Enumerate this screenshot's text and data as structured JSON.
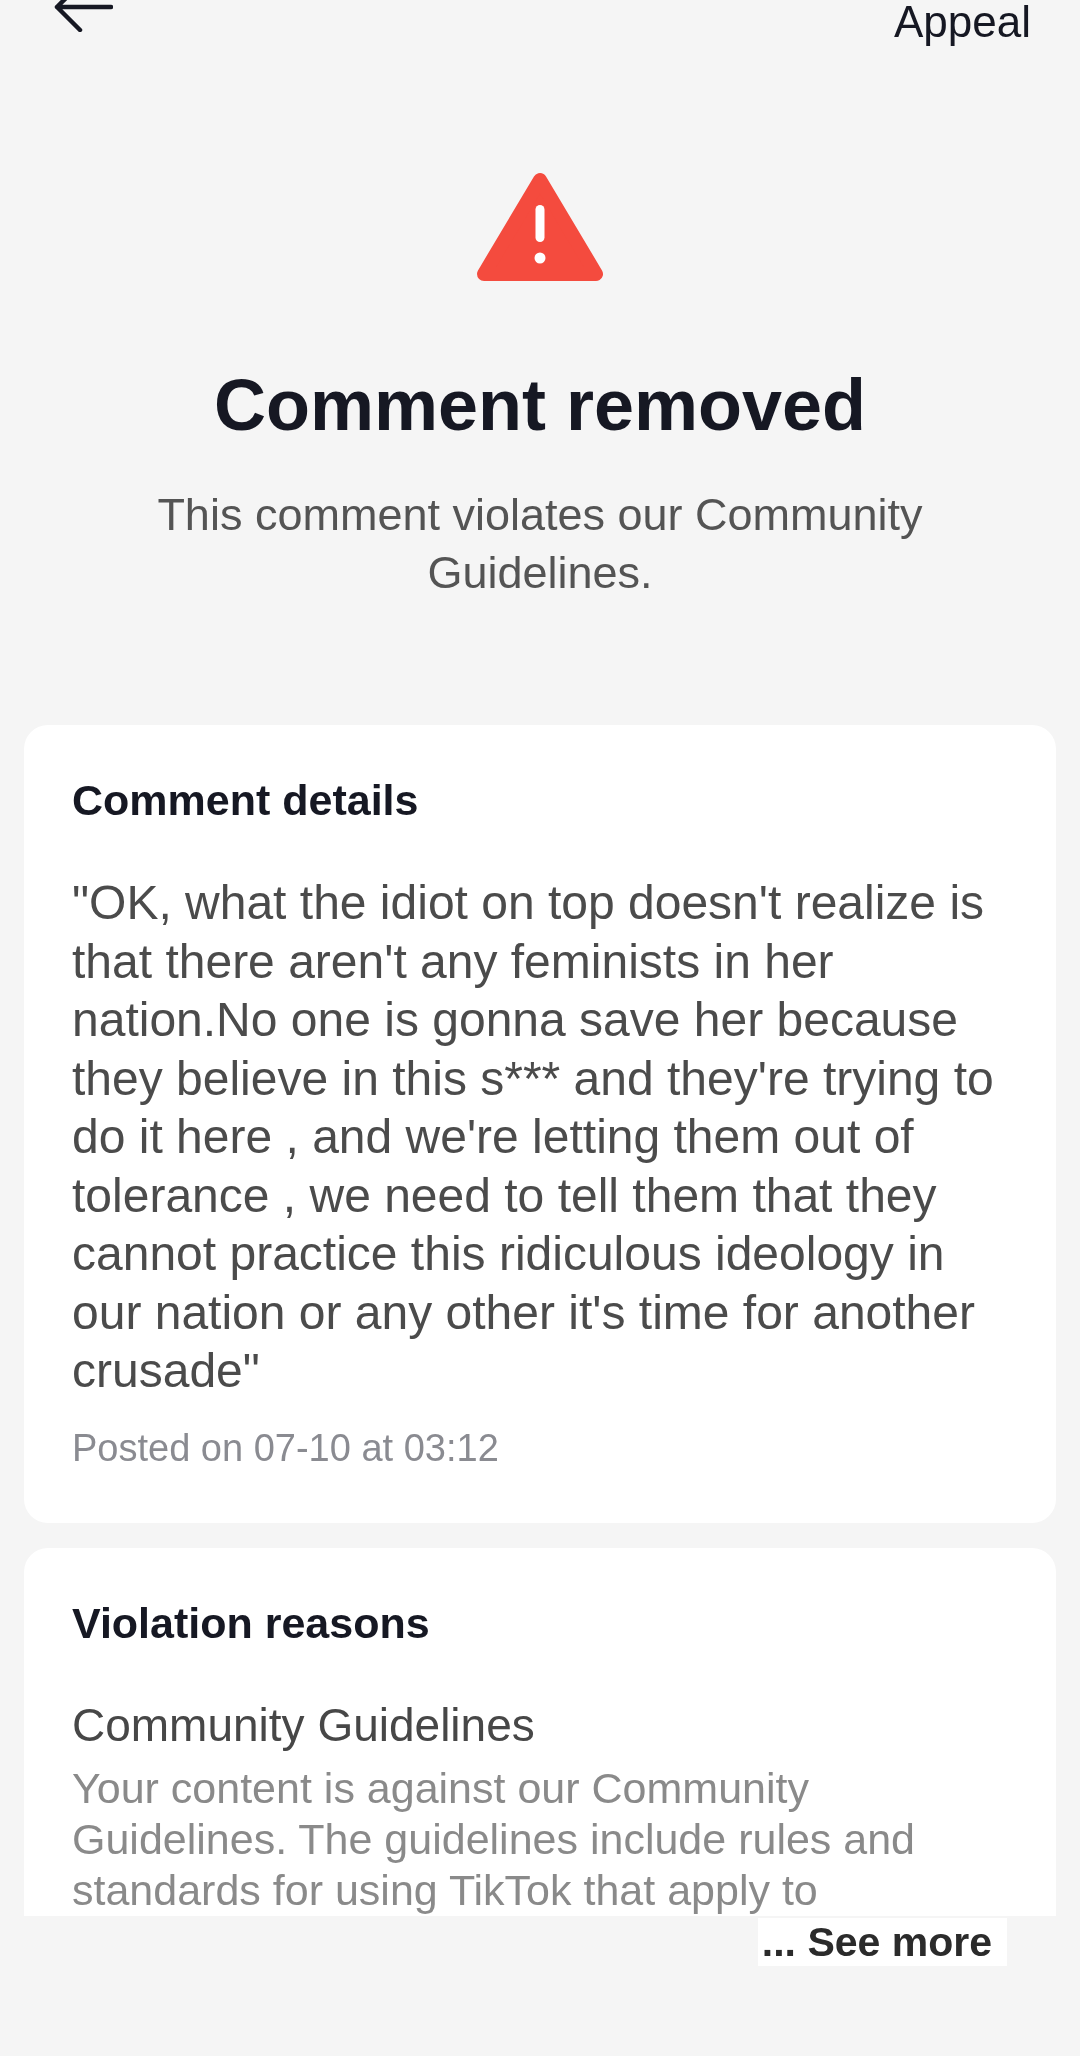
{
  "header": {
    "appeal_button": "Appeal"
  },
  "notice": {
    "title": "Comment removed",
    "message": "This comment violates our Community Guidelines."
  },
  "comment_details": {
    "heading": "Comment details",
    "text": "\"OK, what the idiot on top doesn't realize is that there aren't any feminists in her nation.No one is gonna save her because they believe in this s*** and they're trying to do it here , and we're letting them out of tolerance , we need to tell them that they cannot practice this ridiculous ideology in our nation or any other it's time for another crusade\"",
    "posted": "Posted on 07-10 at 03:12"
  },
  "violation_reasons": {
    "heading": "Violation reasons",
    "items": [
      {
        "title": "Community Guidelines",
        "description": "Your content is against our Community Guidelines. The guidelines include rules and standards for using TikTok that apply to"
      }
    ]
  },
  "see_more": "... See more"
}
